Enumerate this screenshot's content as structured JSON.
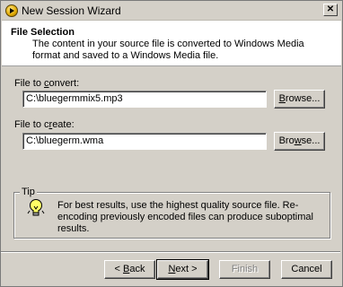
{
  "window": {
    "title": "New Session Wizard",
    "close_label": "✕"
  },
  "header": {
    "title": "File Selection",
    "description": "The content in your source file is converted to Windows Media format and saved to a Windows Media file."
  },
  "convert": {
    "label_pre": "File to ",
    "label_u": "c",
    "label_post": "onvert:",
    "value": "C:\\bluegermmix5.mp3",
    "browse_pre": "",
    "browse_u": "B",
    "browse_post": "rowse..."
  },
  "create": {
    "label_pre": "File to c",
    "label_u": "r",
    "label_post": "eate:",
    "value": "C:\\bluegerm.wma",
    "browse_pre": "Bro",
    "browse_u": "w",
    "browse_post": "se..."
  },
  "tip": {
    "legend": "Tip",
    "text": "For best results, use the highest quality source file. Re-encoding previously encoded files can produce suboptimal results."
  },
  "buttons": {
    "back_arrow": "< ",
    "back_u": "B",
    "back_post": "ack",
    "next_u": "N",
    "next_post": "ext >",
    "finish": "Finish",
    "cancel": "Cancel"
  }
}
